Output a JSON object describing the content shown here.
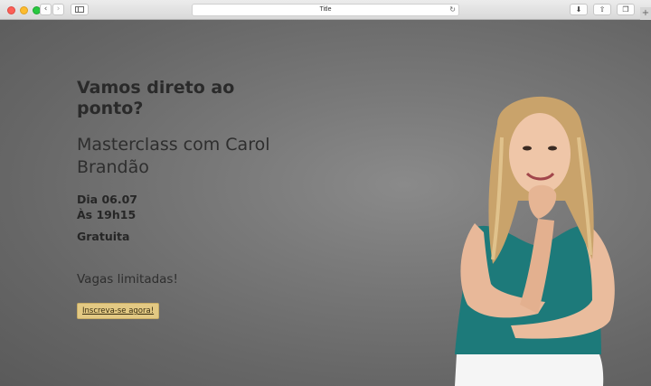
{
  "browser": {
    "tab_title": "Title",
    "back_glyph": "‹",
    "forward_glyph": "›",
    "reload_glyph": "↻",
    "download_glyph": "⬇",
    "share_glyph": "⇧",
    "tabs_glyph": "❐",
    "newtab_glyph": "+"
  },
  "hero": {
    "headline": "Vamos direto ao ponto?",
    "subtitle": "Masterclass com Carol Brandão",
    "date": "Dia 06.07",
    "time": "Às 19h15",
    "price": "Gratuita",
    "limited": "Vagas limitadas!",
    "cta_label": "Inscreva-se agora!"
  },
  "colors": {
    "background": "#6a6a6a",
    "cta_background": "#e3c983",
    "heading_text": "#2a2a2a",
    "top_color": "#1d7a7a",
    "pants_color": "#f5f5f5"
  }
}
